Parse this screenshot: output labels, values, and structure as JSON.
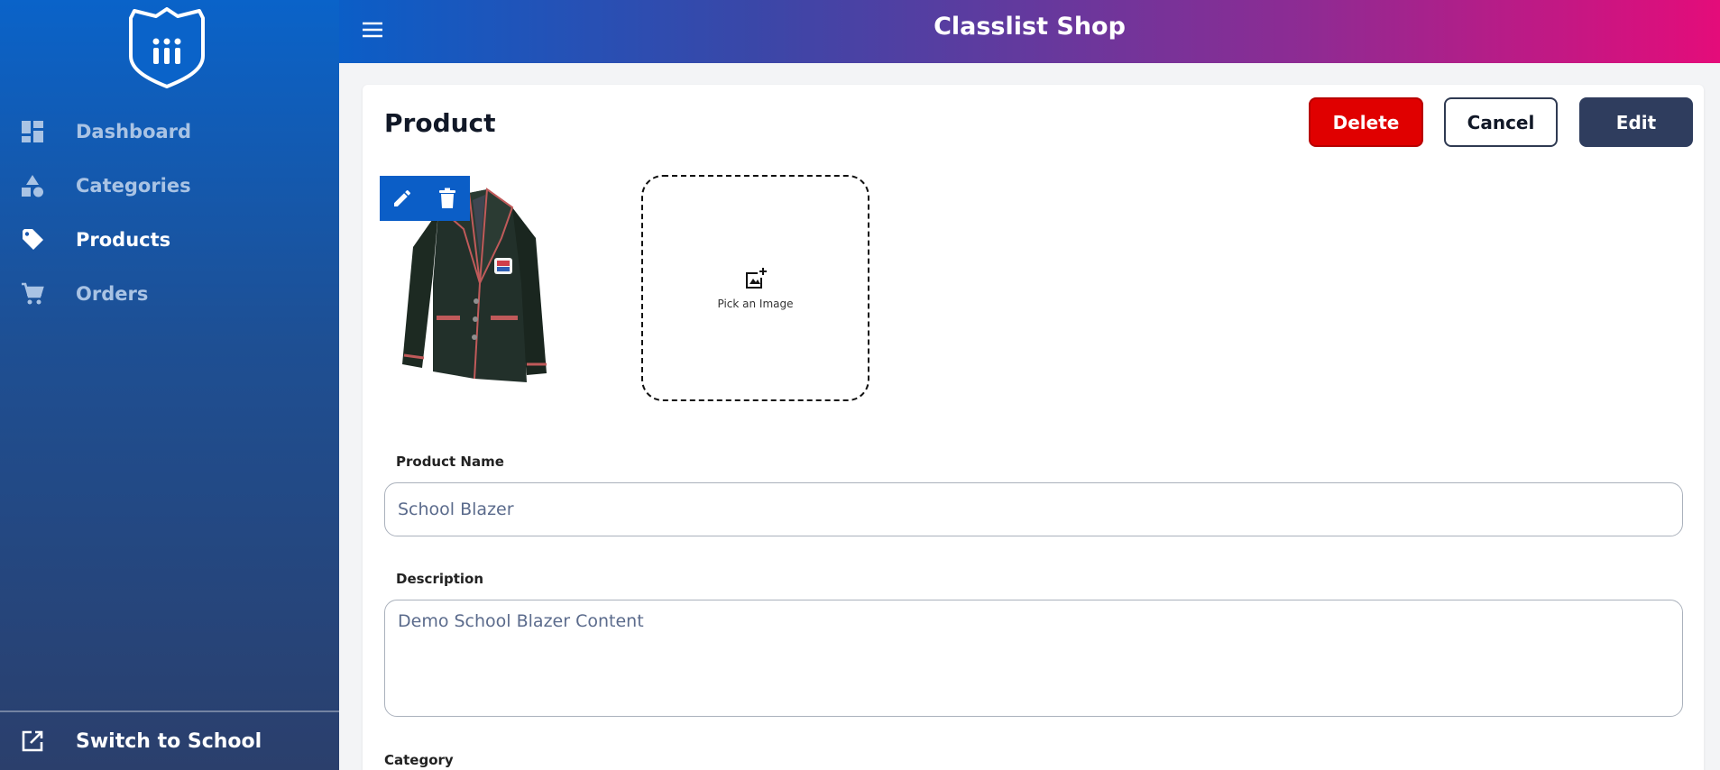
{
  "sidebar": {
    "logo_icon": "shield-logo-icon",
    "items": [
      {
        "label": "Dashboard",
        "icon": "dashboard-icon",
        "active": false
      },
      {
        "label": "Categories",
        "icon": "shapes-icon",
        "active": false
      },
      {
        "label": "Products",
        "icon": "tag-icon",
        "active": true
      },
      {
        "label": "Orders",
        "icon": "cart-icon",
        "active": false
      }
    ],
    "switch_label": "Switch to School",
    "switch_icon": "external-link-icon"
  },
  "header": {
    "title": "Classlist Shop",
    "menu_icon": "hamburger-menu-icon"
  },
  "main": {
    "title": "Product",
    "buttons": {
      "delete": "Delete",
      "cancel": "Cancel",
      "edit": "Edit"
    },
    "image_picker": {
      "label": "Pick an Image"
    },
    "fields": {
      "name_label": "Product Name",
      "name_value": "School Blazer",
      "description_label": "Description",
      "description_value": "Demo School Blazer Content",
      "category_label": "Category"
    }
  },
  "colors": {
    "delete": "#e00000",
    "edit": "#2f3d5e",
    "sidebar_top": "#0a63c9",
    "header_end": "#e40c7a"
  }
}
